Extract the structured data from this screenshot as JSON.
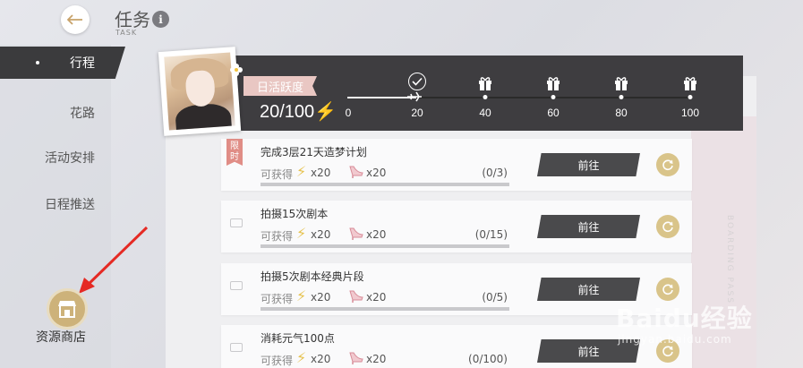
{
  "header": {
    "title": "任务",
    "subtitle": "TASK",
    "info_symbol": "i"
  },
  "sidebar": {
    "items": [
      {
        "label": "行程",
        "active": true
      },
      {
        "label": "花路",
        "active": false
      },
      {
        "label": "活动安排",
        "active": false
      },
      {
        "label": "日程推送",
        "active": false
      }
    ],
    "shop_label": "资源商店"
  },
  "activity": {
    "tag": "日活跃度",
    "value": "20/100",
    "bolt": "⚡",
    "milestones": [
      "0",
      "20",
      "40",
      "60",
      "80",
      "100"
    ],
    "progress": 0.2
  },
  "tasks": [
    {
      "name": "完成3层21天造梦计划",
      "limited": true,
      "limited_text": [
        "限",
        "时"
      ],
      "reward_label": "可获得",
      "reward1": "x20",
      "reward2": "x20",
      "progress": "(0/3)",
      "button": "前往"
    },
    {
      "name": "拍摄15次剧本",
      "limited": false,
      "reward_label": "可获得",
      "reward1": "x20",
      "reward2": "x20",
      "progress": "(0/15)",
      "button": "前往"
    },
    {
      "name": "拍摄5次剧本经典片段",
      "limited": false,
      "reward_label": "可获得",
      "reward1": "x20",
      "reward2": "x20",
      "progress": "(0/5)",
      "button": "前往"
    },
    {
      "name": "消耗元气100点",
      "limited": false,
      "reward_label": "可获得",
      "reward1": "x20",
      "reward2": "x20",
      "progress": "(0/100)",
      "button": "前往"
    }
  ],
  "decor": {
    "boarding": "BOARDING PASS",
    "watermark": "Baidu经验",
    "watermark_sub": "jingyan.baidu.com"
  },
  "colors": {
    "accent_gold": "#d9c48a",
    "dark_bar": "#3e3d40",
    "pink_tag": "#e9c7c3",
    "limited_red": "#e08d86"
  }
}
